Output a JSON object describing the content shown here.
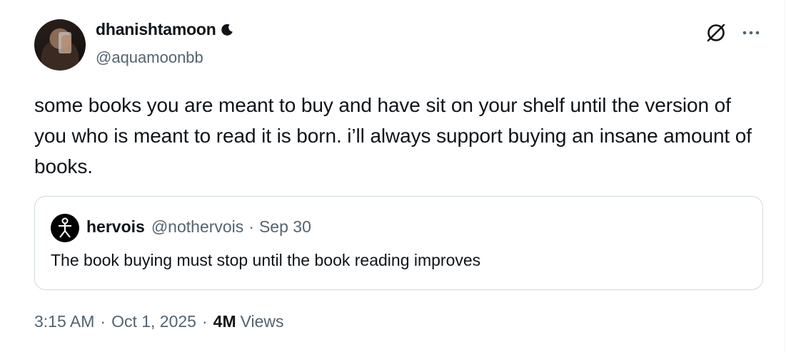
{
  "author": {
    "display_name": "dhanishtamoon",
    "badge_icon": "crescent-moon-icon",
    "handle": "@aquamoonbb"
  },
  "tweet": {
    "text": "some books you are meant to buy and have sit on your shelf until the version of you who is meant to read it is born. i’ll always support buying an insane amount of books."
  },
  "quoted_tweet": {
    "display_name": "hervois",
    "handle": "@nothervois",
    "separator": "·",
    "date": "Sep 30",
    "text": "The book buying must stop until the book reading improves"
  },
  "meta": {
    "time": "3:15 AM",
    "separator": "·",
    "date": "Oct 1, 2025",
    "views_count": "4M",
    "views_label": "Views"
  },
  "icons": {
    "grok": "grok-icon",
    "more": "more-icon"
  },
  "colors": {
    "text_primary": "#0f1419",
    "text_secondary": "#536471",
    "border": "#cfd9de"
  }
}
